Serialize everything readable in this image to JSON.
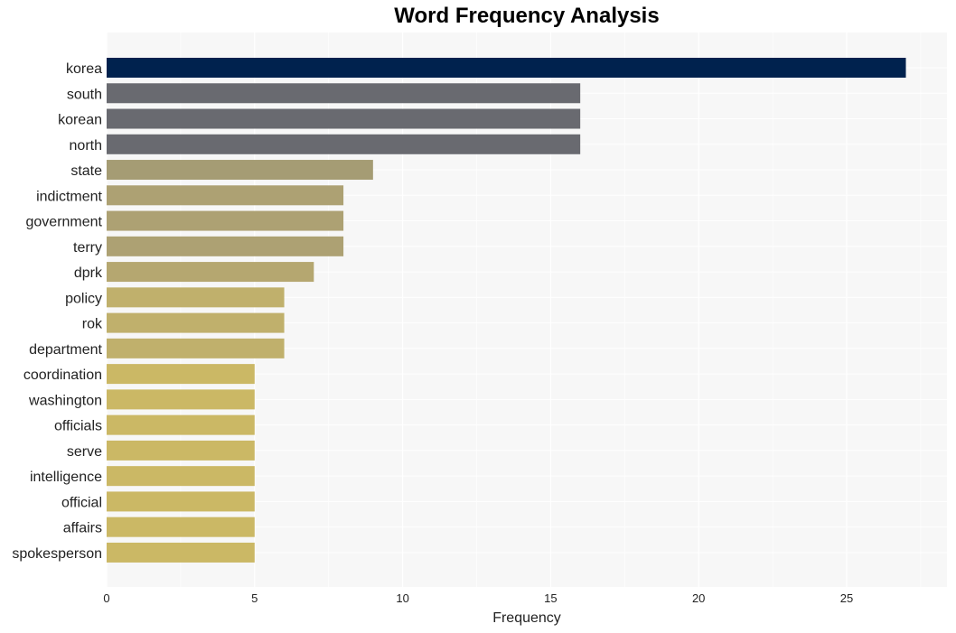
{
  "chart_data": {
    "type": "bar",
    "orientation": "horizontal",
    "title": "Word Frequency Analysis",
    "xlabel": "Frequency",
    "ylabel": "",
    "xlim": [
      0,
      28.4
    ],
    "xticks": [
      0,
      5,
      10,
      15,
      20,
      25
    ],
    "grid": true,
    "legend": "none",
    "categories": [
      "korea",
      "south",
      "korean",
      "north",
      "state",
      "indictment",
      "government",
      "terry",
      "dprk",
      "policy",
      "rok",
      "department",
      "coordination",
      "washington",
      "officials",
      "serve",
      "intelligence",
      "official",
      "affairs",
      "spokesperson"
    ],
    "values": [
      27,
      16,
      16,
      16,
      9,
      8,
      8,
      8,
      7,
      6,
      6,
      6,
      5,
      5,
      5,
      5,
      5,
      5,
      5,
      5
    ],
    "colors": [
      "#00224e",
      "#696a70",
      "#696a70",
      "#696a70",
      "#a59c74",
      "#ada173",
      "#ada173",
      "#ada173",
      "#b5a770",
      "#c0b06c",
      "#c0b06c",
      "#c0b06c",
      "#cbb865",
      "#cbb865",
      "#cbb865",
      "#cbb865",
      "#cbb865",
      "#cbb865",
      "#cbb865",
      "#cbb865"
    ]
  },
  "style": {
    "plot_background": "#f7f7f7",
    "grid_color": "#ffffff"
  }
}
